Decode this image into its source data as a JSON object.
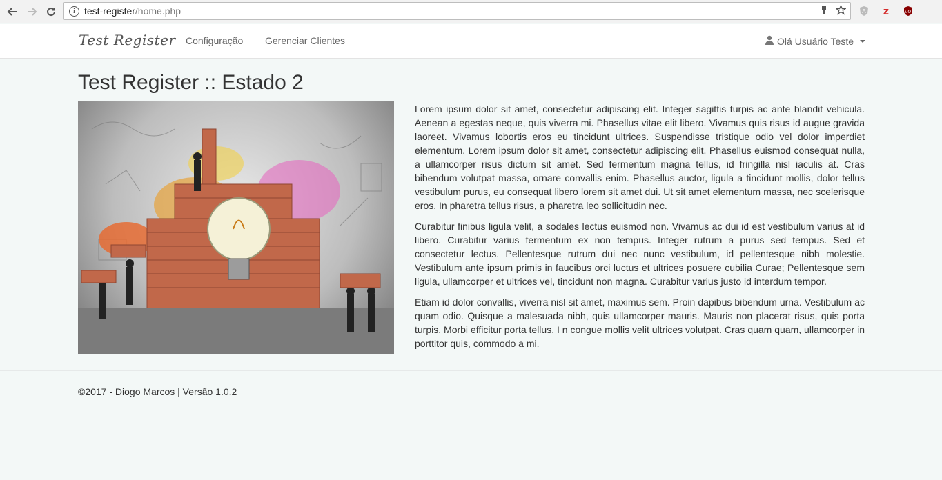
{
  "browser": {
    "url_host": "test-register",
    "url_path": "/home.php",
    "extensions": [
      "angular-icon",
      "zotero-icon",
      "ublock-icon"
    ]
  },
  "navbar": {
    "brand": "Test Register",
    "links": [
      "Configuração",
      "Gerenciar Clientes"
    ],
    "user_label": "Olá Usuário Teste"
  },
  "main": {
    "title": "Test Register :: Estado 2",
    "paragraphs": [
      "Lorem ipsum dolor sit amet, consectetur adipiscing elit. Integer sagittis turpis ac ante blandit vehicula. Aenean a egestas neque, quis viverra mi. Phasellus vitae elit libero. Vivamus quis risus id augue gravida laoreet. Vivamus lobortis eros eu tincidunt ultrices. Suspendisse tristique odio vel dolor imperdiet elementum. Lorem ipsum dolor sit amet, consectetur adipiscing elit. Phasellus euismod consequat nulla, a ullamcorper risus dictum sit amet. Sed fermentum magna tellus, id fringilla nisl iaculis at. Cras bibendum volutpat massa, ornare convallis enim. Phasellus auctor, ligula a tincidunt mollis, dolor tellus vestibulum purus, eu consequat libero lorem sit amet dui. Ut sit amet elementum massa, nec scelerisque eros. In pharetra tellus risus, a pharetra leo sollicitudin nec.",
      "Curabitur finibus ligula velit, a sodales lectus euismod non. Vivamus ac dui id est vestibulum varius at id libero. Curabitur varius fermentum ex non tempus. Integer rutrum a purus sed tempus. Sed et consectetur lectus. Pellentesque rutrum dui nec nunc vestibulum, id pellentesque nibh molestie. Vestibulum ante ipsum primis in faucibus orci luctus et ultrices posuere cubilia Curae; Pellentesque sem ligula, ullamcorper et ultrices vel, tincidunt non magna. Curabitur varius justo id interdum tempor.",
      "Etiam id dolor convallis, viverra nisl sit amet, maximus sem. Proin dapibus bibendum urna. Vestibulum ac quam odio. Quisque a malesuada nibh, quis ullamcorper mauris. Mauris non placerat risus, quis porta turpis. Morbi efficitur porta tellus. I n congue mollis velit ultrices volutpat. Cras quam quam, ullamcorper in porttitor quis, commodo a mi."
    ]
  },
  "footer": {
    "text": "©2017 - Diogo Marcos | Versão 1.0.2"
  }
}
